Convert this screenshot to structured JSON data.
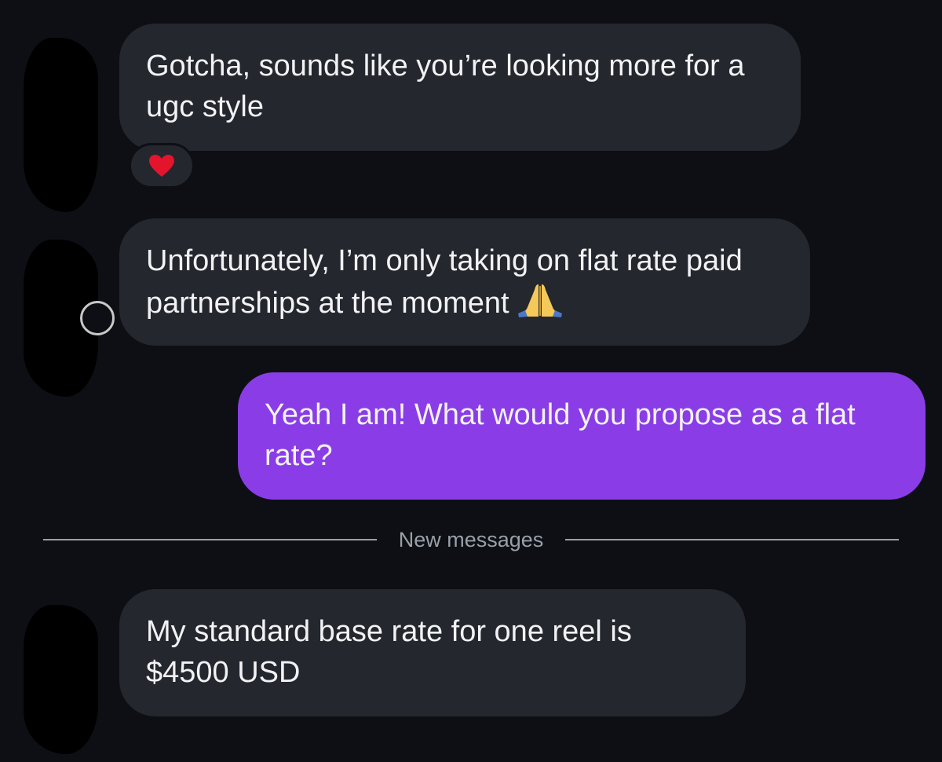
{
  "conversation": {
    "messages": [
      {
        "sender": "them",
        "text": "Gotcha, sounds like you’re looking more for a ugc style",
        "reaction": "heart-icon"
      },
      {
        "sender": "them",
        "text": "Unfortunately, I’m only taking on flat rate paid partnerships at the moment",
        "emoji": "folded-hands-icon"
      },
      {
        "sender": "me",
        "text": "Yeah I am! What would you propose as a flat rate?"
      },
      {
        "sender": "them",
        "text": "My standard base rate for one reel is $4500 USD"
      }
    ],
    "divider_label": "New messages"
  },
  "colors": {
    "background": "#0d0f14",
    "incoming_bubble": "#24272d",
    "outgoing_bubble": "#8a3de6",
    "divider": "#9aa0a8"
  }
}
